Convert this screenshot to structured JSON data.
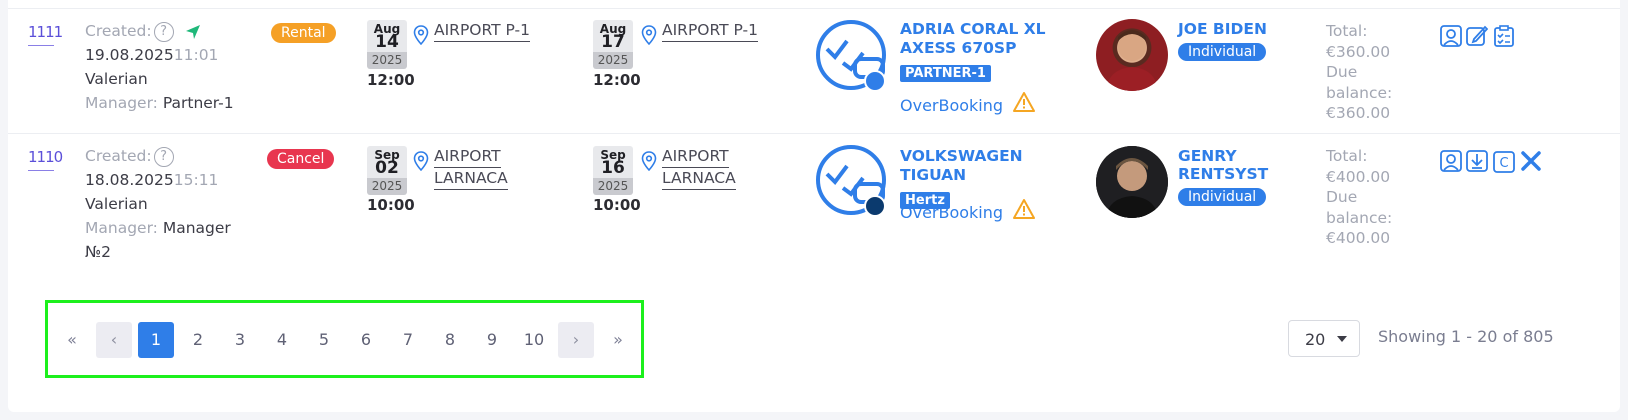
{
  "rows": [
    {
      "id": "1111",
      "created_label": "Created:",
      "created_date": "19.08.2025",
      "created_time": "11:01",
      "user": "Valerian",
      "manager_label": "Manager:",
      "manager_value": "Partner-1",
      "status": "Rental",
      "status_color": "#f5a026",
      "pickup": {
        "month": "Aug",
        "day": "14",
        "year": "2025",
        "time": "12:00",
        "location": "AIRPORT P-1"
      },
      "return": {
        "month": "Aug",
        "day": "17",
        "year": "2025",
        "time": "12:00",
        "location": "AIRPORT P-1"
      },
      "car_title": "ADRIA CORAL XL AXESS 670SP",
      "car_tag": "PARTNER-1",
      "car_dot_color": "#2f7ee8",
      "overbooking": "OverBooking",
      "customer_name": "JOE BIDEN",
      "customer_type": "Individual",
      "total_label": "Total:",
      "total": "€360.00",
      "due_label_1": "Due",
      "due_label_2": "balance:",
      "due": "€360.00",
      "actions": [
        "view-icon",
        "edit-icon",
        "checklist-icon"
      ]
    },
    {
      "id": "1110",
      "created_label": "Created:",
      "created_date": "18.08.2025",
      "created_time": "15:11",
      "user": "Valerian",
      "manager_label": "Manager:",
      "manager_value": "Manager",
      "manager_value_2": "№2",
      "status": "Cancel",
      "status_color": "#e8364f",
      "pickup": {
        "month": "Sep",
        "day": "02",
        "year": "2025",
        "time": "10:00",
        "location_1": "AIRPORT",
        "location_2": "LARNACA"
      },
      "return": {
        "month": "Sep",
        "day": "16",
        "year": "2025",
        "time": "10:00",
        "location_1": "AIRPORT",
        "location_2": "LARNACA"
      },
      "car_title": "VOLKSWAGEN TIGUAN",
      "car_tag": "Hertz",
      "car_dot_color": "#0b3a6e",
      "overbooking": "OverBooking",
      "customer_name_1": "GENRY",
      "customer_name_2": "RENTSYST",
      "customer_type": "Individual",
      "total_label": "Total:",
      "total": "€400.00",
      "due_label_1": "Due",
      "due_label_2": "balance:",
      "due": "€400.00",
      "actions": [
        "view-icon",
        "download-icon",
        "c-icon",
        "close-icon"
      ]
    }
  ],
  "pagination": {
    "first": "«",
    "prev": "‹",
    "pages": [
      "1",
      "2",
      "3",
      "4",
      "5",
      "6",
      "7",
      "8",
      "9",
      "10"
    ],
    "active_page": "1",
    "next": "›",
    "last": "»",
    "page_size": "20",
    "showing": "Showing 1 - 20 of 805"
  },
  "colors": {
    "accent": "#2f7ee8",
    "highlight_box": "#1cf01c",
    "warning": "#f5a623",
    "telegram": "#1fb87a"
  }
}
